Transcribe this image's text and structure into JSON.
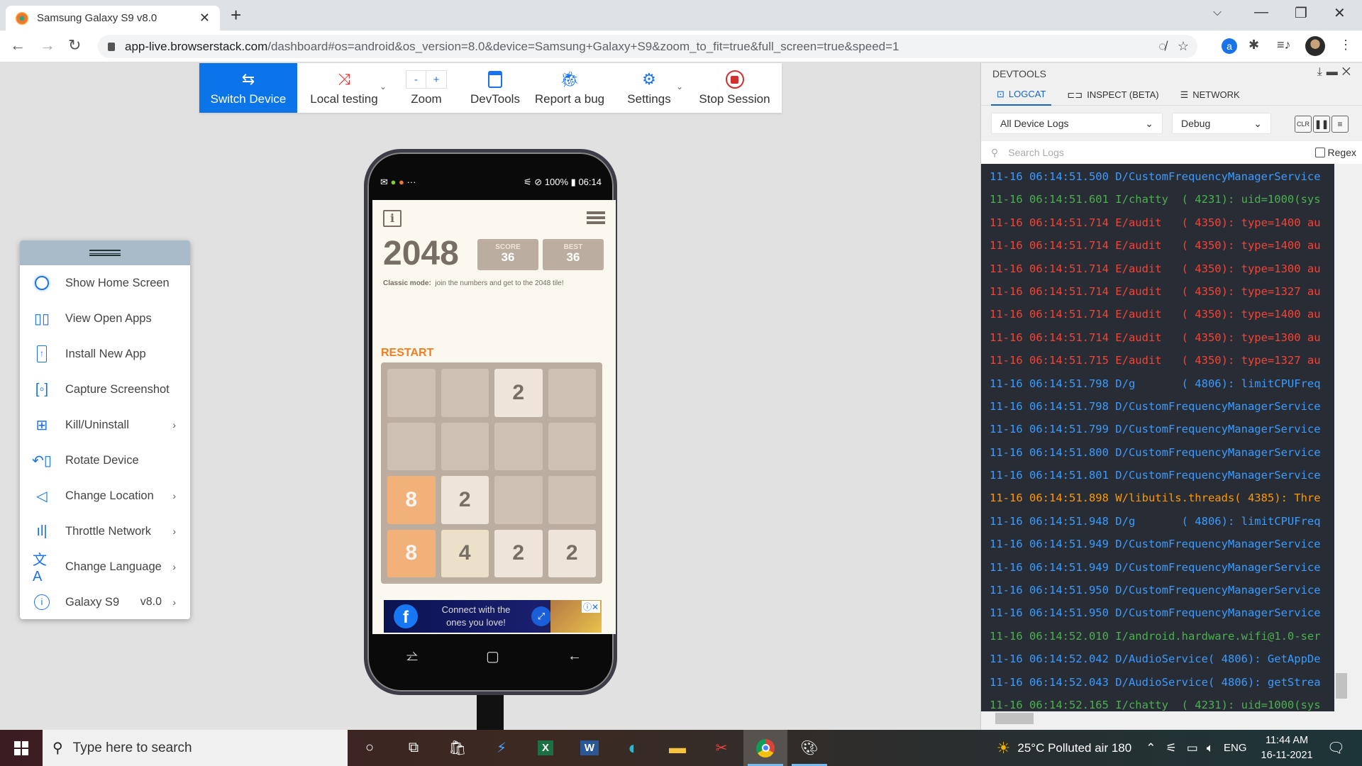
{
  "browser": {
    "tab_title": "Samsung Galaxy S9 v8.0",
    "url_host": "app-live.browserstack.com",
    "url_path": "/dashboard#os=android&os_version=8.0&device=Samsung+Galaxy+S9&zoom_to_fit=true&full_screen=true&speed=1"
  },
  "toolbar": {
    "items": [
      {
        "label": "Switch Device",
        "icon": "switch-arrows-icon"
      },
      {
        "label": "Local testing",
        "icon": "local-testing-icon"
      },
      {
        "label": "Zoom",
        "icon": "zoom-icon",
        "minus": "-",
        "plus": "+"
      },
      {
        "label": "DevTools",
        "icon": "devtools-icon"
      },
      {
        "label": "Report a bug",
        "icon": "bug-icon"
      },
      {
        "label": "Settings",
        "icon": "gear-icon"
      },
      {
        "label": "Stop Session",
        "icon": "stop-icon"
      }
    ]
  },
  "sidemenu": {
    "items": [
      {
        "label": "Show Home Screen",
        "icon": "home-circle-icon"
      },
      {
        "label": "View Open Apps",
        "icon": "open-apps-icon"
      },
      {
        "label": "Install New App",
        "icon": "install-app-icon"
      },
      {
        "label": "Capture Screenshot",
        "icon": "screenshot-icon"
      },
      {
        "label": "Kill/Uninstall",
        "icon": "apps-grid-icon",
        "submenu": true
      },
      {
        "label": "Rotate Device",
        "icon": "rotate-icon"
      },
      {
        "label": "Change Location",
        "icon": "location-arrow-icon",
        "submenu": true
      },
      {
        "label": "Throttle Network",
        "icon": "signal-bars-icon",
        "submenu": true
      },
      {
        "label": "Change Language",
        "icon": "translate-icon",
        "submenu": true
      },
      {
        "label": "Galaxy S9",
        "icon": "info-icon",
        "version": "v8.0",
        "submenu": true
      }
    ]
  },
  "phone": {
    "status": {
      "battery": "100%",
      "time": "06:14"
    },
    "game": {
      "title": "2048",
      "score_label": "SCORE",
      "score": "36",
      "best_label": "BEST",
      "best": "36",
      "mode_label": "Classic mode:",
      "mode_text": "join the numbers and get to the 2048 tile!",
      "restart": "RESTART",
      "board": [
        [
          0,
          0,
          2,
          0
        ],
        [
          0,
          0,
          0,
          0
        ],
        [
          8,
          2,
          0,
          0
        ],
        [
          8,
          4,
          2,
          2
        ]
      ]
    },
    "ad": {
      "text_line1": "Connect with the",
      "text_line2": "ones you love!"
    }
  },
  "devtools": {
    "title": "DEVTOOLS",
    "tabs": [
      {
        "label": "LOGCAT",
        "active": true
      },
      {
        "label": "INSPECT (BETA)",
        "active": false
      },
      {
        "label": "NETWORK",
        "active": false
      }
    ],
    "source_select": "All Device Logs",
    "level_select": "Debug",
    "clear_label": "CLR",
    "search_placeholder": "Search Logs",
    "regex_label": "Regex",
    "logs": [
      {
        "level": "D",
        "text": "11-16 06:14:51.500 D/CustomFrequencyManagerService"
      },
      {
        "level": "I",
        "text": "11-16 06:14:51.601 I/chatty  ( 4231): uid=1000(sys"
      },
      {
        "level": "E",
        "text": "11-16 06:14:51.714 E/audit   ( 4350): type=1400 au"
      },
      {
        "level": "E",
        "text": "11-16 06:14:51.714 E/audit   ( 4350): type=1400 au"
      },
      {
        "level": "E",
        "text": "11-16 06:14:51.714 E/audit   ( 4350): type=1300 au"
      },
      {
        "level": "E",
        "text": "11-16 06:14:51.714 E/audit   ( 4350): type=1327 au"
      },
      {
        "level": "E",
        "text": "11-16 06:14:51.714 E/audit   ( 4350): type=1400 au"
      },
      {
        "level": "E",
        "text": "11-16 06:14:51.714 E/audit   ( 4350): type=1300 au"
      },
      {
        "level": "E",
        "text": "11-16 06:14:51.715 E/audit   ( 4350): type=1327 au"
      },
      {
        "level": "D",
        "text": "11-16 06:14:51.798 D/g       ( 4806): limitCPUFreq"
      },
      {
        "level": "D",
        "text": "11-16 06:14:51.798 D/CustomFrequencyManagerService"
      },
      {
        "level": "D",
        "text": "11-16 06:14:51.799 D/CustomFrequencyManagerService"
      },
      {
        "level": "D",
        "text": "11-16 06:14:51.800 D/CustomFrequencyManagerService"
      },
      {
        "level": "D",
        "text": "11-16 06:14:51.801 D/CustomFrequencyManagerService"
      },
      {
        "level": "W",
        "text": "11-16 06:14:51.898 W/libutils.threads( 4385): Thre"
      },
      {
        "level": "D",
        "text": "11-16 06:14:51.948 D/g       ( 4806): limitCPUFreq"
      },
      {
        "level": "D",
        "text": "11-16 06:14:51.949 D/CustomFrequencyManagerService"
      },
      {
        "level": "D",
        "text": "11-16 06:14:51.949 D/CustomFrequencyManagerService"
      },
      {
        "level": "D",
        "text": "11-16 06:14:51.950 D/CustomFrequencyManagerService"
      },
      {
        "level": "D",
        "text": "11-16 06:14:51.950 D/CustomFrequencyManagerService"
      },
      {
        "level": "I",
        "text": "11-16 06:14:52.010 I/android.hardware.wifi@1.0-ser"
      },
      {
        "level": "D",
        "text": "11-16 06:14:52.042 D/AudioService( 4806): GetAppDe"
      },
      {
        "level": "D",
        "text": "11-16 06:14:52.043 D/AudioService( 4806): getStrea"
      },
      {
        "level": "I",
        "text": "11-16 06:14:52.165 I/chatty  ( 4231): uid=1000(sys"
      }
    ]
  },
  "taskbar": {
    "search_placeholder": "Type here to search",
    "apps": [
      "cortana-icon",
      "task-view-icon",
      "store-icon",
      "power-automate-icon",
      "excel-icon",
      "word-icon",
      "edge-icon",
      "file-explorer-icon",
      "snipping-tool-icon",
      "chrome-icon",
      "paint-icon"
    ],
    "weather": "25°C  Polluted air 180",
    "language": "ENG",
    "time": "11:44 AM",
    "date": "16-11-2021"
  }
}
